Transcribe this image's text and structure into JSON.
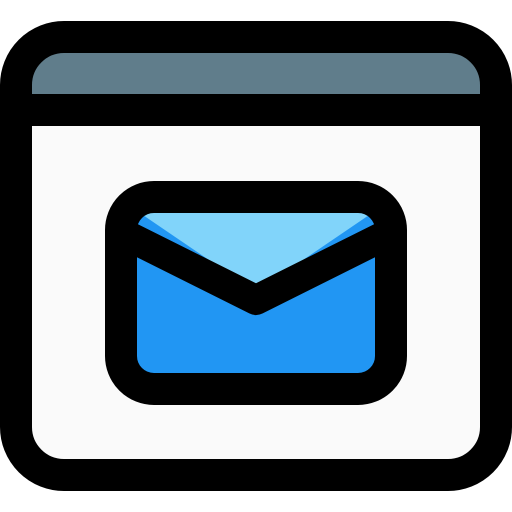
{
  "icon": {
    "name": "browser-email-icon",
    "colors": {
      "outline": "#000000",
      "window_body": "#fafafa",
      "title_bar": "#607d8b",
      "envelope_body": "#2196f3",
      "envelope_flap": "#81d4fa"
    }
  }
}
